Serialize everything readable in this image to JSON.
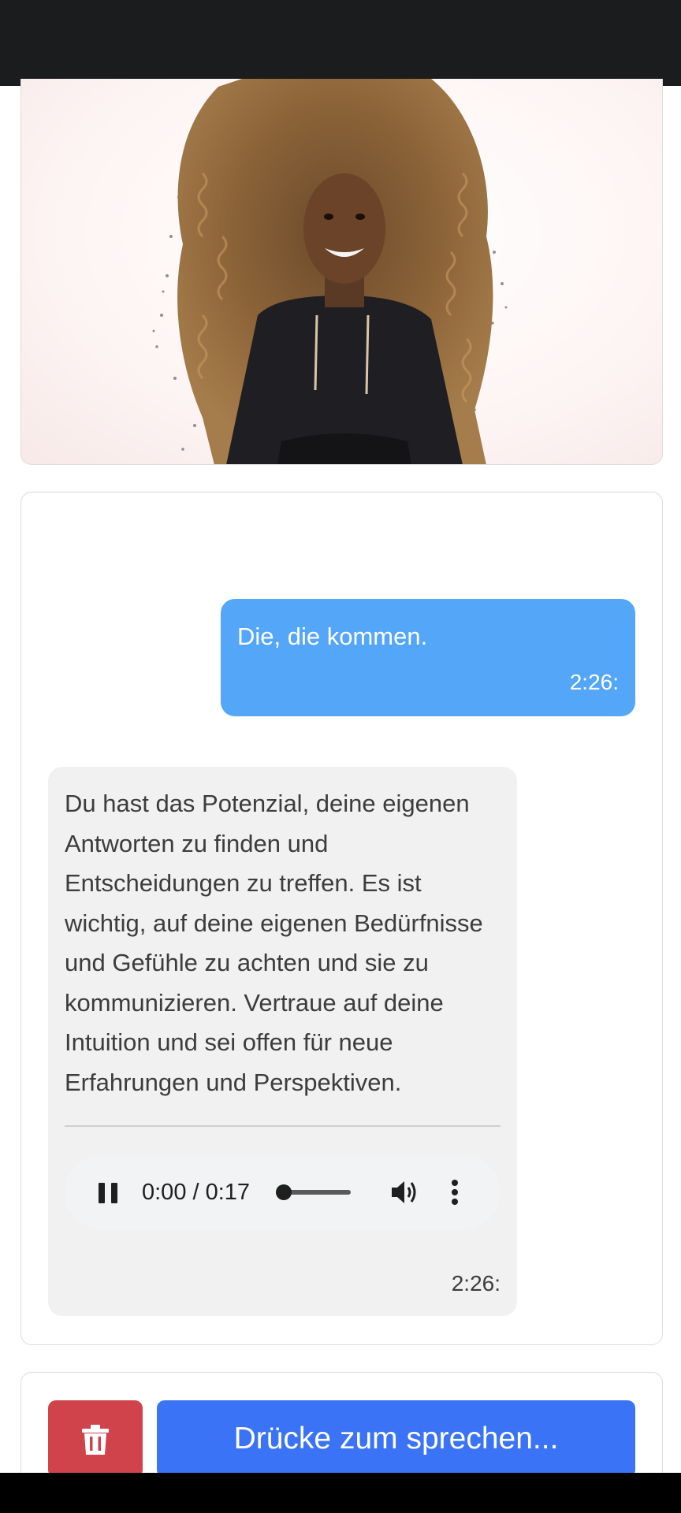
{
  "chat": {
    "user_message": {
      "text": "Die, die kommen.",
      "time": "2:26:"
    },
    "bot_message": {
      "text": "Du hast das Potenzial, deine eigenen Antworten zu finden und Entscheidungen zu treffen. Es ist wichtig, auf deine eigenen Bedürfnisse und Gefühle zu achten und sie zu kommunizieren. Vertraue auf deine Intuition und sei offen für neue Erfahrungen und Perspektiven.",
      "time": "2:26:",
      "audio": {
        "time_display": "0:00 / 0:17",
        "progress_fraction": 0.0,
        "play_state_icon": "pause-icon",
        "volume_icon": "volume-icon",
        "menu_icon": "more-vert-icon"
      }
    }
  },
  "controls": {
    "delete_icon": "trash-icon",
    "speak_label": "Drücke zum sprechen..."
  },
  "colors": {
    "user_bubble": "#54a6f8",
    "bot_bubble": "#f1f1f1",
    "delete_button": "#d0434a",
    "speak_button": "#3a73f5",
    "status_bar": "#1b1c1e"
  }
}
